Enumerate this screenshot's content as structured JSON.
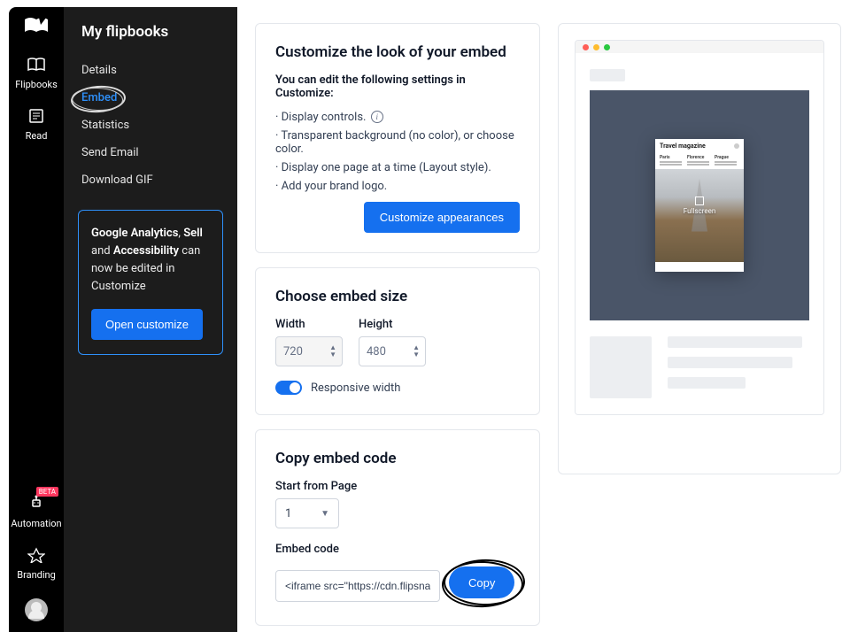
{
  "rail": {
    "items": [
      {
        "label": "Flipbooks"
      },
      {
        "label": "Read"
      }
    ],
    "bottom": [
      {
        "label": "Automation",
        "badge": "BETA"
      },
      {
        "label": "Branding"
      }
    ]
  },
  "sidebar": {
    "title": "My flipbooks",
    "links": [
      {
        "label": "Details"
      },
      {
        "label": "Embed"
      },
      {
        "label": "Statistics"
      },
      {
        "label": "Send Email"
      },
      {
        "label": "Download GIF"
      }
    ],
    "info": {
      "text_parts": {
        "a": "Google Analytics",
        "b": ", ",
        "c": "Sell",
        "d": " and ",
        "e": "Accessibility",
        "f": " can now be edited in Customize"
      },
      "button": "Open customize"
    }
  },
  "customize": {
    "heading": "Customize the look of your embed",
    "subheading": "You can edit the following settings in Customize:",
    "items": [
      "· Display controls.",
      "· Transparent background (no color), or choose color.",
      "· Display one page at a time (Layout style).",
      "· Add your brand logo."
    ],
    "button": "Customize appearances"
  },
  "size": {
    "heading": "Choose embed size",
    "width_label": "Width",
    "height_label": "Height",
    "width_value": "720",
    "height_value": "480",
    "toggle_label": "Responsive width"
  },
  "copy": {
    "heading": "Copy embed code",
    "start_label": "Start from Page",
    "start_value": "1",
    "code_label": "Embed code",
    "code_value": "<iframe src=\"https://cdn.flipsnack",
    "button": "Copy"
  },
  "preview": {
    "mag_title": "Travel magazine",
    "col1": "Paris",
    "col2": "Florence",
    "col3": "Prague",
    "fullscreen": "Fullscreen"
  }
}
